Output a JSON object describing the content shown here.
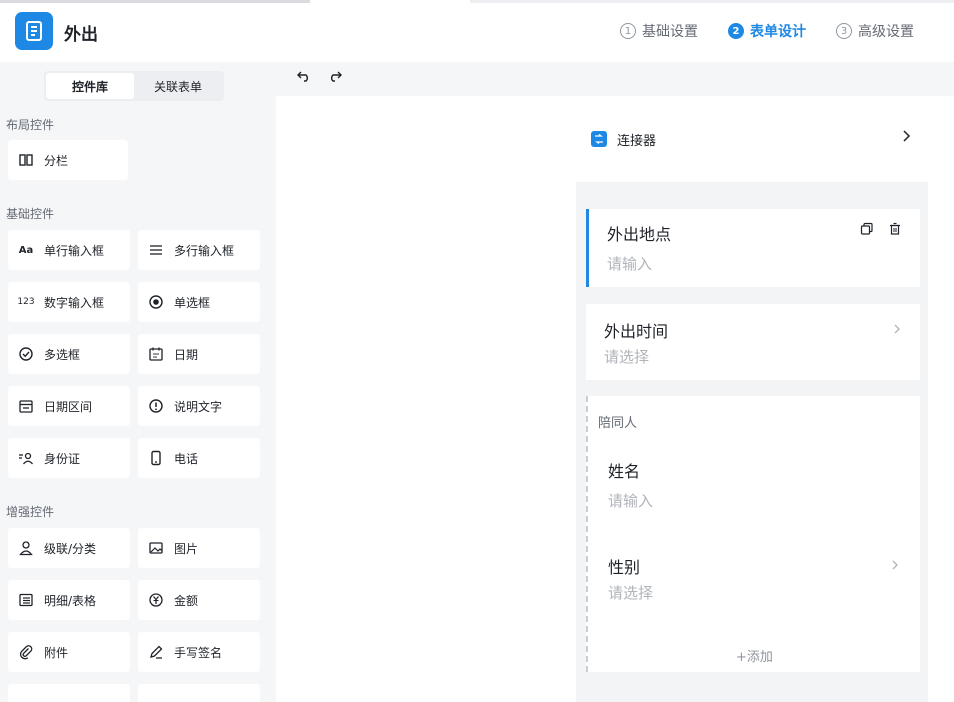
{
  "header": {
    "title": "外出",
    "steps": [
      {
        "num": "1",
        "label": "基础设置"
      },
      {
        "num": "2",
        "label": "表单设计"
      },
      {
        "num": "3",
        "label": "高级设置"
      }
    ]
  },
  "left": {
    "tabs": [
      "控件库",
      "关联表单"
    ],
    "sections": {
      "layout": "布局控件",
      "basic": "基础控件",
      "enhanced": "增强控件"
    },
    "layout_controls": [
      {
        "label": "分栏",
        "icon": "columns-icon"
      }
    ],
    "basic_controls": [
      {
        "label": "单行输入框",
        "icon": "text-aa-icon"
      },
      {
        "label": "多行输入框",
        "icon": "multiline-icon"
      },
      {
        "label": "数字输入框",
        "icon": "number-icon"
      },
      {
        "label": "单选框",
        "icon": "radio-icon"
      },
      {
        "label": "多选框",
        "icon": "checkbox-icon"
      },
      {
        "label": "日期",
        "icon": "calendar-icon"
      },
      {
        "label": "日期区间",
        "icon": "date-range-icon"
      },
      {
        "label": "说明文字",
        "icon": "info-icon"
      },
      {
        "label": "身份证",
        "icon": "id-card-icon"
      },
      {
        "label": "电话",
        "icon": "phone-icon"
      }
    ],
    "enhanced_controls": [
      {
        "label": "级联/分类",
        "icon": "user-icon"
      },
      {
        "label": "图片",
        "icon": "image-icon"
      },
      {
        "label": "明细/表格",
        "icon": "table-icon"
      },
      {
        "label": "金额",
        "icon": "yuan-icon"
      },
      {
        "label": "附件",
        "icon": "paperclip-icon"
      },
      {
        "label": "手写签名",
        "icon": "pen-icon"
      }
    ]
  },
  "canvas": {
    "connector_label": "连接器",
    "fields": [
      {
        "label": "外出地点",
        "placeholder": "请输入"
      },
      {
        "label": "外出时间",
        "placeholder": "请选择"
      }
    ],
    "group": {
      "title": "陪同人",
      "fields": [
        {
          "label": "姓名",
          "placeholder": "请输入"
        },
        {
          "label": "性别",
          "placeholder": "请选择"
        }
      ],
      "add_label": "+添加"
    }
  },
  "colors": {
    "accent": "#1e88e5",
    "placeholder": "#b0b4ba"
  }
}
